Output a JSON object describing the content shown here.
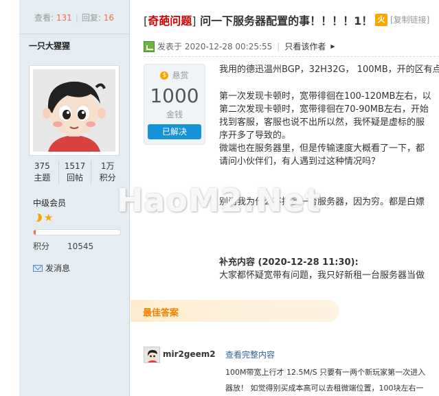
{
  "stats_bar": {
    "views_label": "查看:",
    "views": "131",
    "replies_label": "回复:",
    "replies": "16"
  },
  "author": {
    "name": "一只大猩猩",
    "topics": "375",
    "topics_label": "主题",
    "posts": "1517",
    "posts_label": "回帖",
    "credits": "1万",
    "credits_label": "积分",
    "level": "中级会员",
    "level_progress": 0.02,
    "points_label": "积分",
    "points": "10545",
    "message_label": "发消息"
  },
  "thread": {
    "category": "奇葩问题",
    "title": "问一下服务器配置的事！！！！1！",
    "tool_icon": "火",
    "copy_link": "[复制链接]",
    "posted_prefix": "发表于",
    "posted_time": "2020-12-28 00:25:55",
    "only_author": "只看该作者"
  },
  "reward": {
    "label": "悬赏",
    "amount": "1000",
    "unit": "金钱",
    "status": "已解决"
  },
  "content": {
    "line1": "我用的德迅温州BGP，32H32G， 100MB，开的区有点",
    "line2": "第一次发现卡顿时，宽带徘徊在100-120MB左右，以",
    "line3": "第二次发现卡顿时，宽带徘徊在70-90MB左右，开始",
    "line4": "找到客服，客服也说不出所以然，我怀疑是虚标的服",
    "line5": "序开多了导致的。",
    "line6": "微端也在服务器里，但是传输速度大概看了一下，都",
    "line7": "请问小伙伴们，有人遇到过这种情况吗？",
    "line8": "别问我为什么不搞多一台服务器，因为穷。都是白嫖"
  },
  "supplement": {
    "title": "补充内容 (2020-12-28 11:30):",
    "body": "大家都怀疑宽带有问题，我只好新租一台服务器当做"
  },
  "best_answer": {
    "label": "最佳答案",
    "user": "mir2geem2",
    "view_full": "查看完整内容",
    "line1": "100M带宽上行才 12.5M/S 只要有一两个新玩家第一次进入",
    "line2": "器放！ 如觉得别买成本高可以去租微端位置，100块左右一"
  },
  "watermark": "HaoM2.Net",
  "colors": {
    "accent_red": "#c00000",
    "link_blue": "#336699",
    "solved_blue": "#1693d6",
    "best_orange": "#f08300",
    "sidebar_bg": "#e5edf2"
  }
}
